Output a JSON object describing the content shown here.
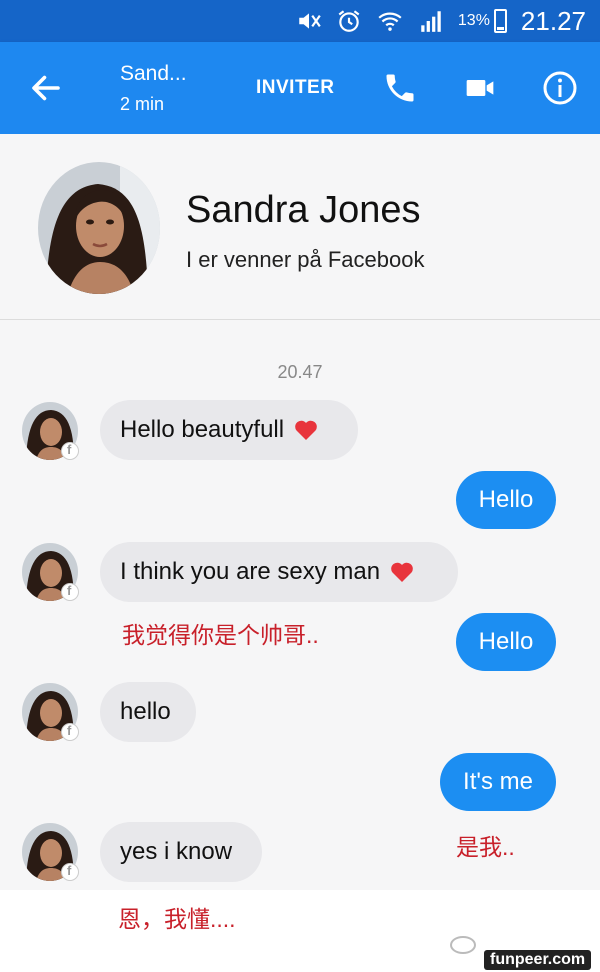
{
  "status_bar": {
    "icons": [
      "mute-icon",
      "alarm-icon",
      "wifi-icon",
      "signal-icon",
      "battery-icon"
    ],
    "battery": "13%",
    "time": "21.27"
  },
  "header": {
    "contact_name": "Sand...",
    "last_active": "2 min",
    "invite_label": "INVITER",
    "icons": [
      "back-arrow-icon",
      "phone-icon",
      "video-camera-icon",
      "info-icon"
    ]
  },
  "profile": {
    "name": "Sandra Jones",
    "subtitle": "I er venner på Facebook"
  },
  "conversation": {
    "timestamp": "20.47",
    "messages": [
      {
        "from": "them",
        "text": "Hello beautyfull",
        "emoji": "heart"
      },
      {
        "from": "me",
        "text": "Hello"
      },
      {
        "from": "them",
        "text": "I think you are sexy man",
        "emoji": "heart"
      },
      {
        "from": "me",
        "text": "Hello"
      },
      {
        "from": "them",
        "text": "hello"
      },
      {
        "from": "me",
        "text": "It's me"
      },
      {
        "from": "them",
        "text": "yes i know"
      }
    ],
    "annotations": [
      "我觉得你是个帅哥..",
      "是我..",
      "恩，我懂...."
    ]
  },
  "watermark": "funpeer.com",
  "colors": {
    "status_bar": "#1565c8",
    "app_bar": "#1e88f0",
    "outgoing_bubble": "#1c8ef2",
    "incoming_bubble": "#e8e8eb",
    "annotation": "#c8202a",
    "heart": "#e8343c"
  }
}
